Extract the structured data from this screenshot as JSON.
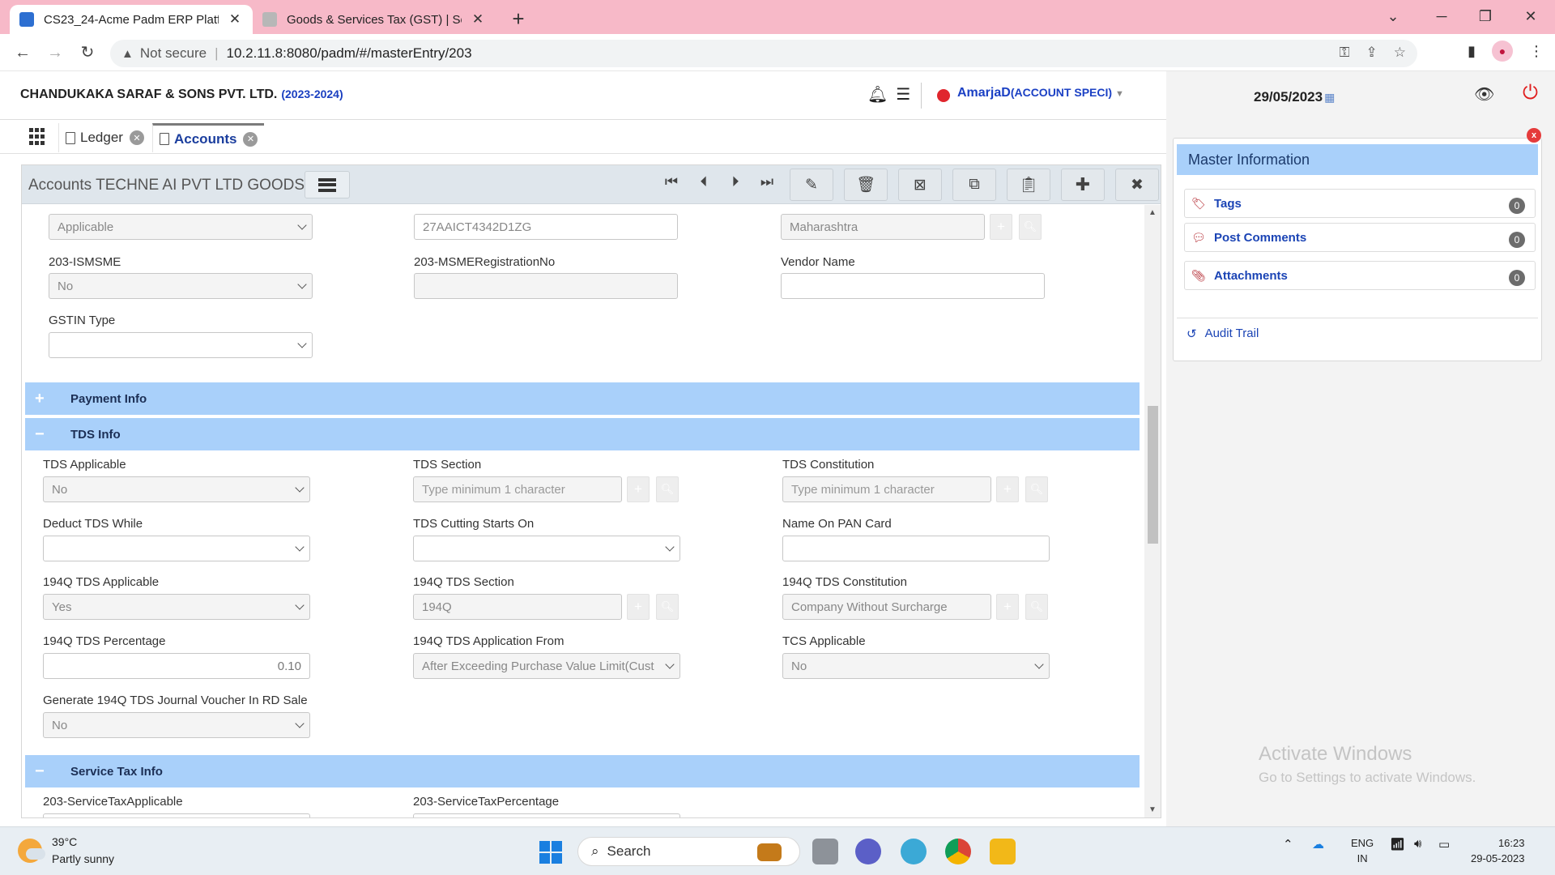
{
  "browser": {
    "tabs": [
      {
        "title": "CS23_24-Acme Padm ERP Platform",
        "active": true
      },
      {
        "title": "Goods & Services Tax (GST) | Services",
        "active": false
      }
    ],
    "address": {
      "security": "Not secure",
      "url": "10.2.11.8:8080/padm/#/masterEntry/203"
    }
  },
  "header": {
    "company": "CHANDUKAKA SARAF & SONS PVT. LTD.",
    "year": "(2023-2024)",
    "user": "AmarjaD",
    "role": "(ACCOUNT SPECI)",
    "date": "29/05/2023"
  },
  "app_tabs": [
    {
      "label": "Ledger",
      "active": false
    },
    {
      "label": "Accounts",
      "active": true
    }
  ],
  "toolbar": {
    "title": "Accounts TECHNE AI PVT LTD GOODS"
  },
  "top_fields": {
    "applicable_value": "Applicable",
    "gstin_value": "27AAICT4342D1ZG",
    "state_value": "Maharashtra",
    "ismsme_label": "203-ISMSME",
    "ismsme_value": "No",
    "msme_reg_label": "203-MSMERegistrationNo",
    "msme_reg_value": "",
    "vendor_name_label": "Vendor Name",
    "vendor_name_value": "",
    "gstin_type_label": "GSTIN Type",
    "gstin_type_value": ""
  },
  "sections": {
    "payment_info": "Payment Info",
    "tds_info": "TDS Info",
    "service_tax_info": "Service Tax Info"
  },
  "tds": {
    "tds_applicable_label": "TDS Applicable",
    "tds_applicable_value": "No",
    "tds_section_label": "TDS Section",
    "tds_section_placeholder": "Type minimum 1 character",
    "tds_constitution_label": "TDS Constitution",
    "tds_constitution_placeholder": "Type minimum 1 character",
    "deduct_while_label": "Deduct TDS While",
    "deduct_while_value": "",
    "cutting_starts_label": "TDS Cutting Starts On",
    "cutting_starts_value": "",
    "pan_name_label": "Name On PAN Card",
    "pan_name_value": "",
    "q_applicable_label": "194Q TDS Applicable",
    "q_applicable_value": "Yes",
    "q_section_label": "194Q TDS Section",
    "q_section_value": "194Q",
    "q_constitution_label": "194Q TDS Constitution",
    "q_constitution_value": "Company Without Surcharge",
    "q_percentage_label": "194Q TDS Percentage",
    "q_percentage_value": "0.10",
    "q_application_from_label": "194Q TDS Application From",
    "q_application_from_value": "After Exceeding Purchase Value Limit(Cust",
    "tcs_applicable_label": "TCS Applicable",
    "tcs_applicable_value": "No",
    "gen_voucher_label": "Generate 194Q TDS Journal Voucher In RD Sale",
    "gen_voucher_value": "No"
  },
  "service_tax": {
    "applicable_label": "203-ServiceTaxApplicable",
    "percentage_label": "203-ServiceTaxPercentage"
  },
  "master_info": {
    "title": "Master Information",
    "items": [
      {
        "label": "Tags",
        "count": "0"
      },
      {
        "label": "Post Comments",
        "count": "0"
      },
      {
        "label": "Attachments",
        "count": "0"
      }
    ],
    "audit_trail": "Audit Trail"
  },
  "watermark": {
    "line1": "Activate Windows",
    "line2": "Go to Settings to activate Windows."
  },
  "taskbar": {
    "temperature": "39°C",
    "condition": "Partly sunny",
    "search": "Search",
    "lang1": "ENG",
    "lang2": "IN",
    "time": "16:23",
    "date": "29-05-2023"
  },
  "colors": {
    "section_bg": "#a9d0fa",
    "tabbar_bg": "#f7b9c8",
    "link_blue": "#1b44b5",
    "power_red": "#e01e1e"
  }
}
